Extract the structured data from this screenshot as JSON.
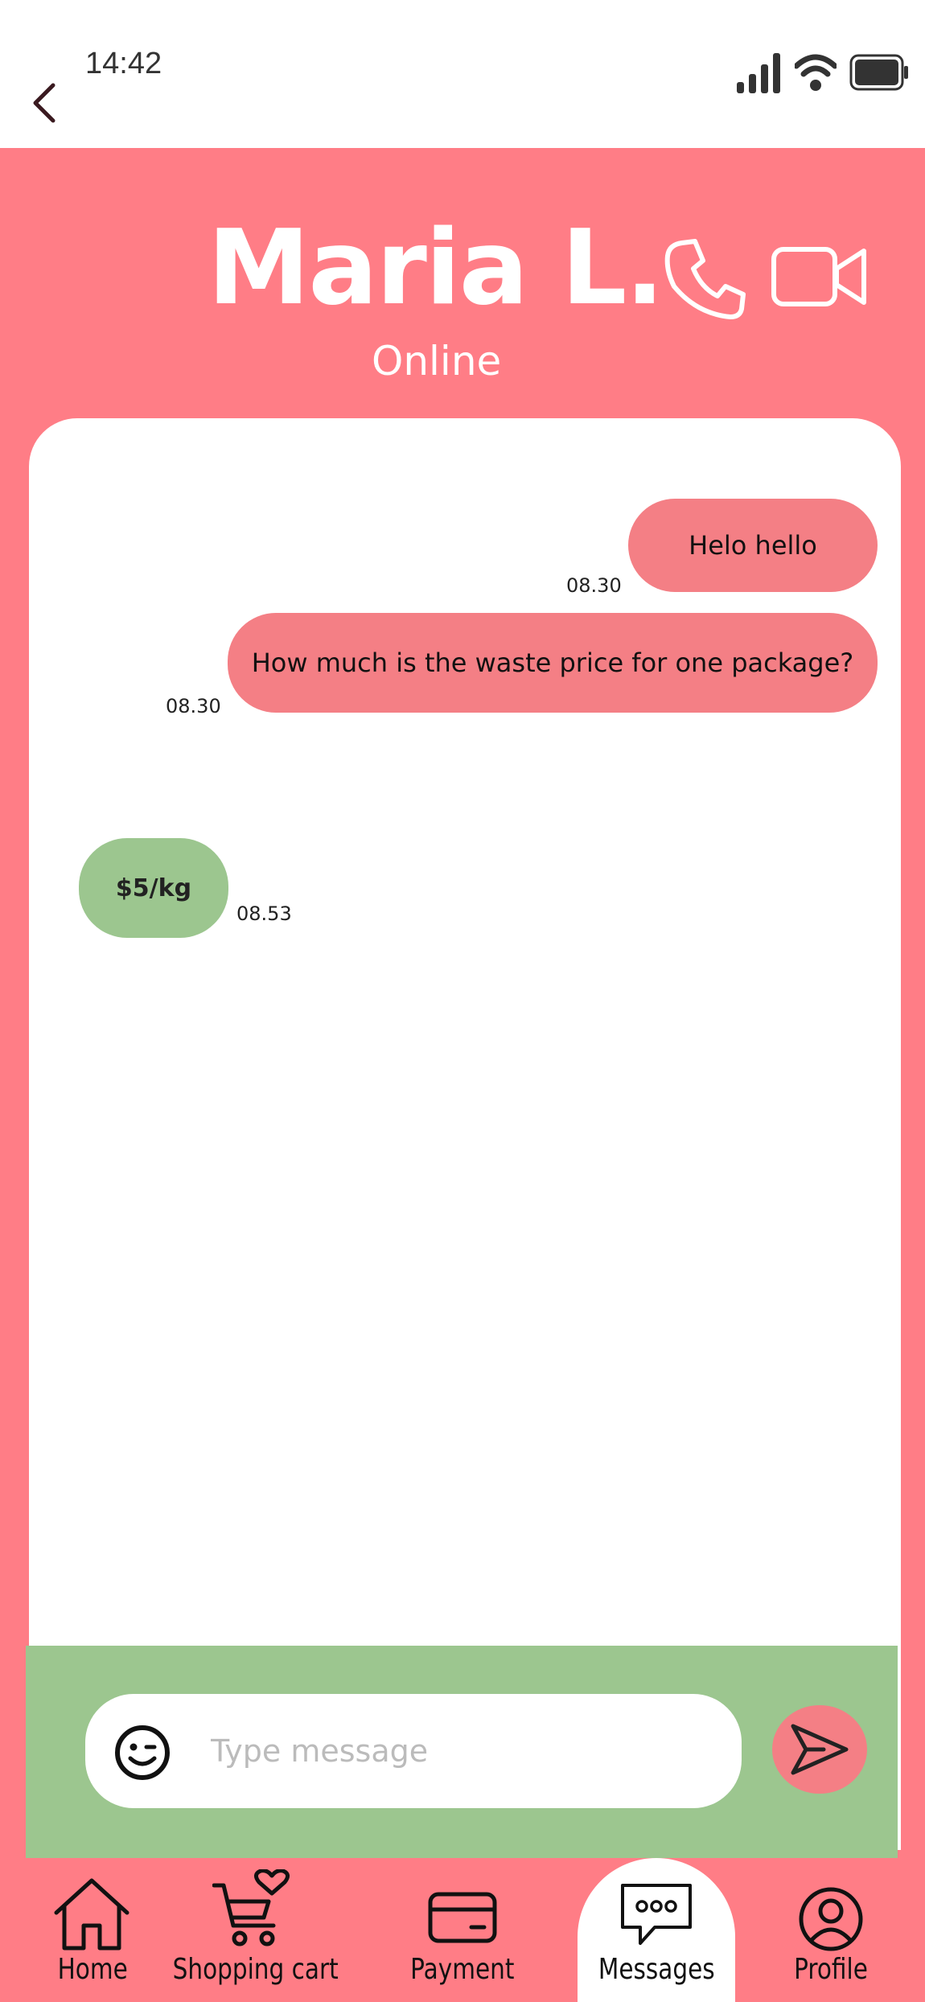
{
  "status_bar": {
    "time": "14:42",
    "icons": [
      "signal-icon",
      "wifi-icon",
      "battery-icon"
    ]
  },
  "header": {
    "contact_name": "Maria L.",
    "contact_status": "Online",
    "icons": [
      "phone-icon",
      "video-camera-icon",
      "back-chevron-icon"
    ]
  },
  "messages": [
    {
      "direction": "outgoing",
      "text": "Helo hello",
      "time": "08.30"
    },
    {
      "direction": "outgoing",
      "text": "How much is the waste price for one package?",
      "time": "08.30"
    },
    {
      "direction": "incoming",
      "text": "$5/kg",
      "time": "08.53"
    }
  ],
  "composer": {
    "placeholder": "Type message",
    "value": "",
    "icons": [
      "emoji-icon",
      "send-icon"
    ]
  },
  "nav": {
    "items": [
      {
        "label": "Home",
        "icon": "home-icon",
        "active": false
      },
      {
        "label": "Shopping cart",
        "icon": "shopping-cart-icon",
        "active": false
      },
      {
        "label": "Payment",
        "icon": "credit-card-icon",
        "active": false
      },
      {
        "label": "Messages",
        "icon": "chat-bubble-icon",
        "active": true
      },
      {
        "label": "Profile",
        "icon": "user-icon",
        "active": false
      }
    ]
  },
  "colors": {
    "primary": "#FF7D86",
    "outgoing_bubble": "#F47F85",
    "incoming_bubble": "#9CC68F",
    "composer_bar": "#9CC68F",
    "panel": "#FFFFFF"
  }
}
